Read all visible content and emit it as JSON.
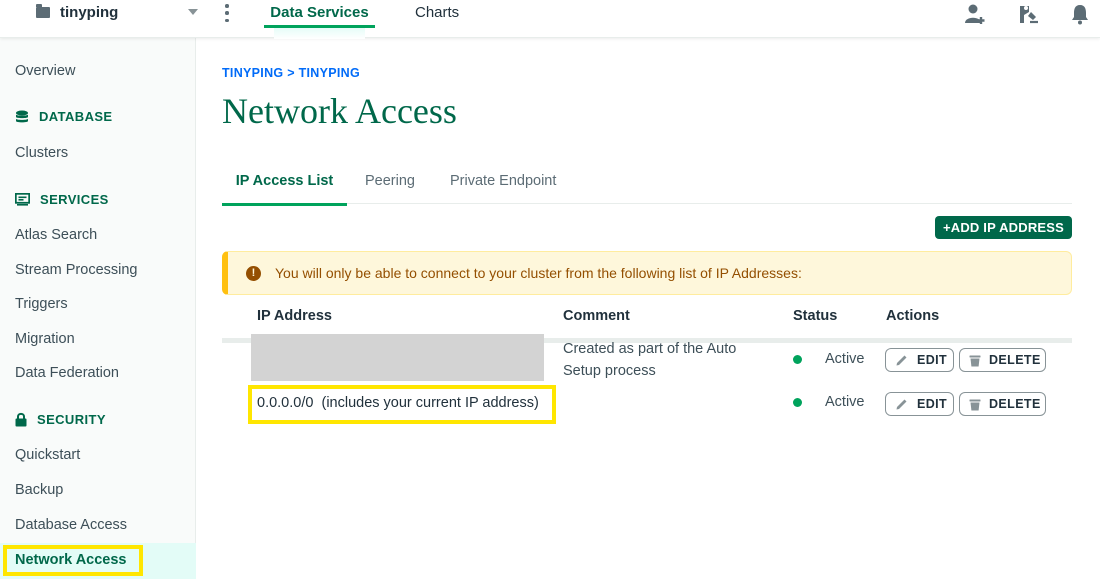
{
  "header": {
    "project_name": "tinyping",
    "tabs": [
      "Data Services",
      "Charts"
    ]
  },
  "sidebar": {
    "overview": "Overview",
    "database_heading": "DATABASE",
    "clusters": "Clusters",
    "services_heading": "SERVICES",
    "services_items": [
      "Atlas Search",
      "Stream Processing",
      "Triggers",
      "Migration",
      "Data Federation"
    ],
    "security_heading": "SECURITY",
    "security_items": [
      "Quickstart",
      "Backup",
      "Database Access"
    ],
    "active_item": "Network Access"
  },
  "main": {
    "breadcrumb": "TINYPING > TINYPING",
    "title": "Network Access",
    "tabs": [
      "IP Access List",
      "Peering",
      "Private Endpoint"
    ],
    "add_button": "+ADD IP ADDRESS",
    "banner_text": "You will only be able to connect to your cluster from the following list of IP Addresses:",
    "table": {
      "headers": [
        "IP Address",
        "Comment",
        "Status",
        "Actions"
      ],
      "rows": [
        {
          "ip": "",
          "comment": "Created as part of the Auto Setup process",
          "status": "Active"
        },
        {
          "ip": "0.0.0.0/0  (includes your current IP address)",
          "comment": "",
          "status": "Active"
        }
      ],
      "edit_label": "EDIT",
      "delete_label": "DELETE"
    }
  },
  "colors": {
    "brand_green": "#00684a",
    "accent_green": "#00a35c",
    "highlight": "#ffe600",
    "link_blue": "#016bf8",
    "warning_bg": "#fef7db"
  }
}
